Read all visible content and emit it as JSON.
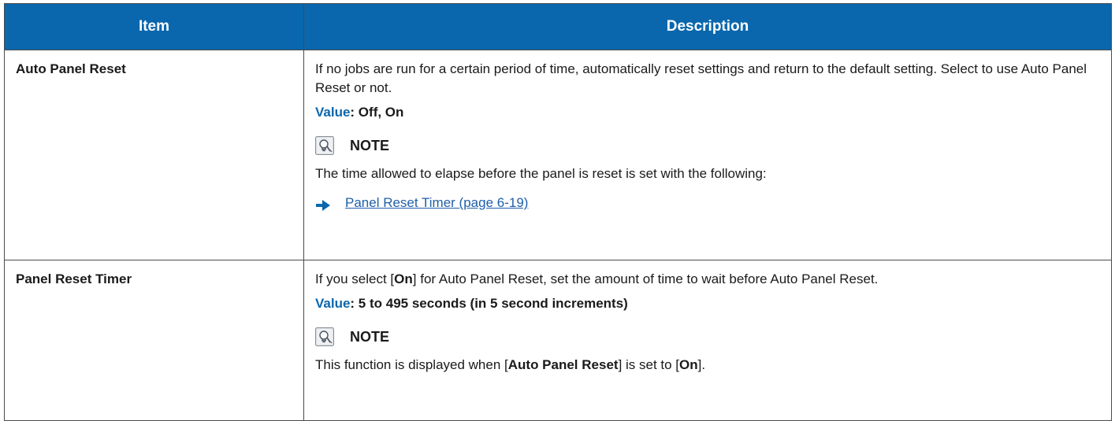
{
  "table": {
    "header": {
      "item": "Item",
      "description": "Description"
    },
    "rows": [
      {
        "item": "Auto Panel Reset",
        "description": "If no jobs are run for a certain period of time, automatically reset settings and return to the default setting. Select to use Auto Panel Reset or not.",
        "value_label": "Value",
        "value_text": ": Off, On",
        "note_title": "NOTE",
        "note_text": "The time allowed to elapse before the panel is reset is set with the following:",
        "ref_link": "Panel Reset Timer (page 6-19)"
      },
      {
        "item": "Panel Reset Timer",
        "description_prefix": "If you select [",
        "description_bold": "On",
        "description_suffix": "] for Auto Panel Reset, set the amount of time to wait before Auto Panel Reset.",
        "value_label": "Value",
        "value_text": ": 5 to 495 seconds (in 5 second increments)",
        "note_title": "NOTE",
        "note_prefix": "This function is displayed when [",
        "note_bold1": "Auto Panel Reset",
        "note_middle": "] is set to [",
        "note_bold2": "On",
        "note_suffix": "]."
      }
    ]
  },
  "colors": {
    "header_bg": "#0a67ad",
    "value_label": "#0a67ad",
    "link": "#1f5fa9",
    "border": "#4b4b4b"
  },
  "icons": {
    "note": "note-lightbulb-icon",
    "reference": "reference-arrow-icon"
  }
}
